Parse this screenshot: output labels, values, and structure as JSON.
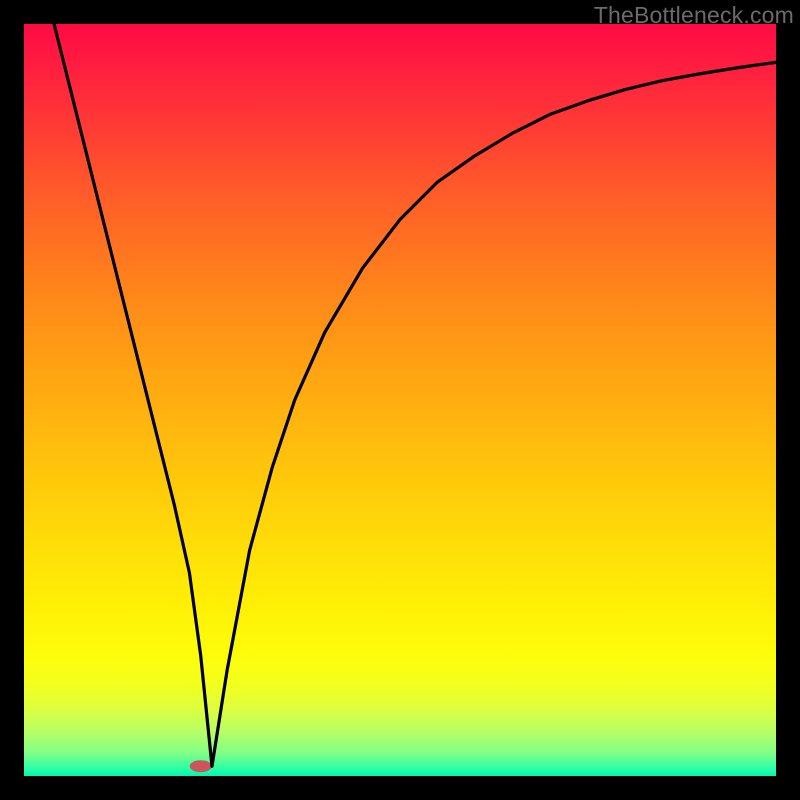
{
  "watermark": "TheBottleneck.com",
  "chart_data": {
    "type": "line",
    "title": "",
    "xlabel": "",
    "ylabel": "",
    "xlim": [
      0,
      100
    ],
    "ylim": [
      0,
      100
    ],
    "series": [
      {
        "name": "black-curve",
        "x": [
          4,
          6,
          8,
          10,
          12,
          14,
          16,
          18,
          20,
          22,
          23.5,
          25,
          27,
          30,
          33,
          36,
          40,
          45,
          50,
          55,
          60,
          65,
          70,
          75,
          80,
          85,
          90,
          95,
          100
        ],
        "values": [
          100,
          92,
          84,
          76,
          68,
          60,
          52,
          44,
          36,
          27,
          16,
          1.3,
          14,
          30,
          41,
          50,
          59,
          67.5,
          74,
          79,
          82.5,
          85.5,
          88,
          89.8,
          91.3,
          92.5,
          93.4,
          94.2,
          94.9
        ]
      }
    ],
    "marker": {
      "x": 23.5,
      "y": 1.3,
      "color": "#cc565c",
      "rx": 11,
      "ry": 6
    },
    "gradient_stops": [
      {
        "pos": 0,
        "color": "#ff0a45"
      },
      {
        "pos": 50,
        "color": "#ffb80e"
      },
      {
        "pos": 85,
        "color": "#fdfd0b"
      },
      {
        "pos": 100,
        "color": "#00f7b2"
      }
    ]
  }
}
